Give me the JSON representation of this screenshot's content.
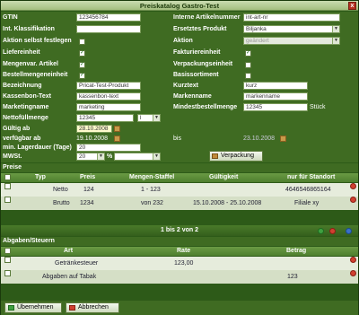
{
  "window": {
    "title": "Preiskatalog Gastro-Test",
    "close": "x"
  },
  "left": {
    "gtin_label": "GTIN",
    "gtin_value": "123456784",
    "int_klass_label": "Int. Klassifikation",
    "int_klass_value": "",
    "aktion_selbst_label": "Aktion selbst festlegen",
    "liefereinheit_label": "Liefereinheit",
    "liefereinheit_checked": "✓",
    "mengenvar_label": "Mengenvar. Artikel",
    "mengenvar_checked": "✓",
    "bestellmenge_label": "Bestellmengeneinheit",
    "bestellmenge_checked": "✓",
    "bezeichnung_label": "Bezeichnung",
    "bezeichnung_value": "Pricat-Test-Produkt",
    "kassenbon_label": "Kassenbon-Text",
    "kassenbon_value": "kassenbon-text",
    "marketing_label": "Marketingname",
    "marketing_value": "marketing",
    "netto_label": "Nettofüllmenge",
    "netto_value": "12345",
    "netto_unit": "l",
    "gueltig_label": "Gültig ab",
    "gueltig_value": "28.10.2008",
    "verfuegbar_label": "verfügbar ab",
    "verfuegbar_value": "19.10.2008",
    "lagerdauer_label": "min. Lagerdauer (Tage)",
    "lagerdauer_value": "20",
    "mwst_label": "MWSt.",
    "mwst_value": "20",
    "mwst_unit": "%"
  },
  "right": {
    "interne_label": "Interne Artikelnummer",
    "interne_value": "int-art-nr",
    "ersetztes_label": "Ersetztes Produkt",
    "ersetztes_value": "Biljanka",
    "aktion_label": "Aktion",
    "aktion_value": "geändert",
    "fakturier_label": "Fakturiereinheit",
    "fakturier_checked": "✓",
    "verpackung_label": "Verpackungseinheit",
    "basis_label": "Basissortiment",
    "kurztext_label": "Kurztext",
    "kurztext_value": "kurz",
    "marken_label": "Markenname",
    "marken_value": "markenname",
    "mindest_label": "Mindestbestellmenge",
    "mindest_value": "12345",
    "mindest_unit": "Stück",
    "bis_label": "bis",
    "bis_value": "23.10.2008",
    "verpackung_button": "Verpackung"
  },
  "preise": {
    "section": "Preise",
    "headers": {
      "typ": "Typ",
      "preis": "Preis",
      "staffel": "Mengen-Staffel",
      "gueltig": "Gültigkeit",
      "standort": "nur für Standort"
    },
    "rows": [
      {
        "typ": "Netto",
        "preis": "124",
        "staffel": "1 - 123",
        "gueltig": "",
        "standort": "4646546865164"
      },
      {
        "typ": "Brutto",
        "preis": "1234",
        "staffel": "von 232",
        "gueltig": "15.10.2008 - 25.10.2008",
        "standort": "Filiale xy"
      }
    ],
    "pager": "1 bis 2 von 2"
  },
  "abgaben": {
    "section": "Abgaben/Steuern",
    "headers": {
      "art": "Art",
      "rate": "Rate",
      "betrag": "Betrag"
    },
    "rows": [
      {
        "art": "Getränkesteuer",
        "rate": "123,00",
        "betrag": ""
      },
      {
        "art": "Abgaben auf Tabak",
        "rate": "",
        "betrag": "123"
      }
    ]
  },
  "footer": {
    "save": "Übernehmen",
    "cancel": "Abbrechen"
  },
  "colors": {
    "panel": "#3f6b22",
    "header": "#a4bf80",
    "row_a": "#e6ecdc",
    "row_b": "#d5dfc6"
  }
}
